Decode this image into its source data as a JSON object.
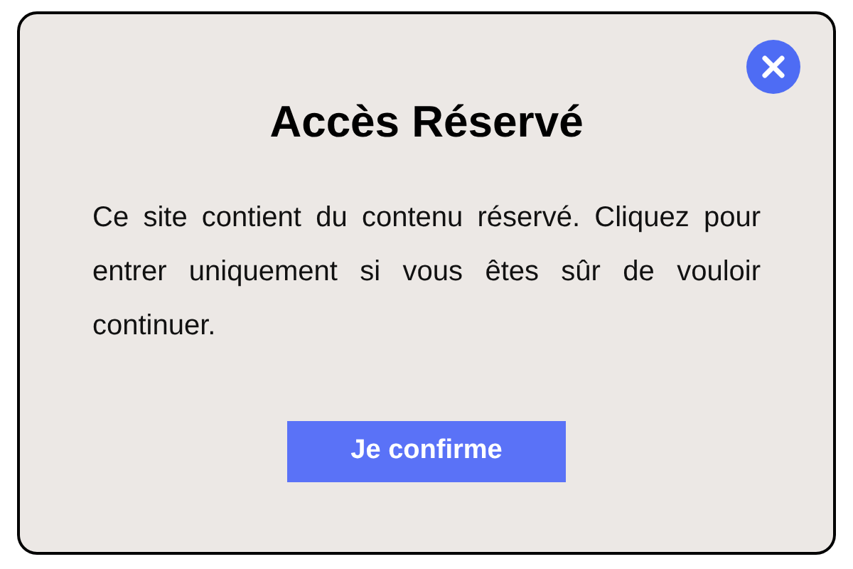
{
  "dialog": {
    "title": "Accès Réservé",
    "message": "Ce site contient du contenu réservé. Cliquez pour entrer uniquement si vous êtes sûr de vouloir continuer.",
    "button": "Je confirme"
  }
}
